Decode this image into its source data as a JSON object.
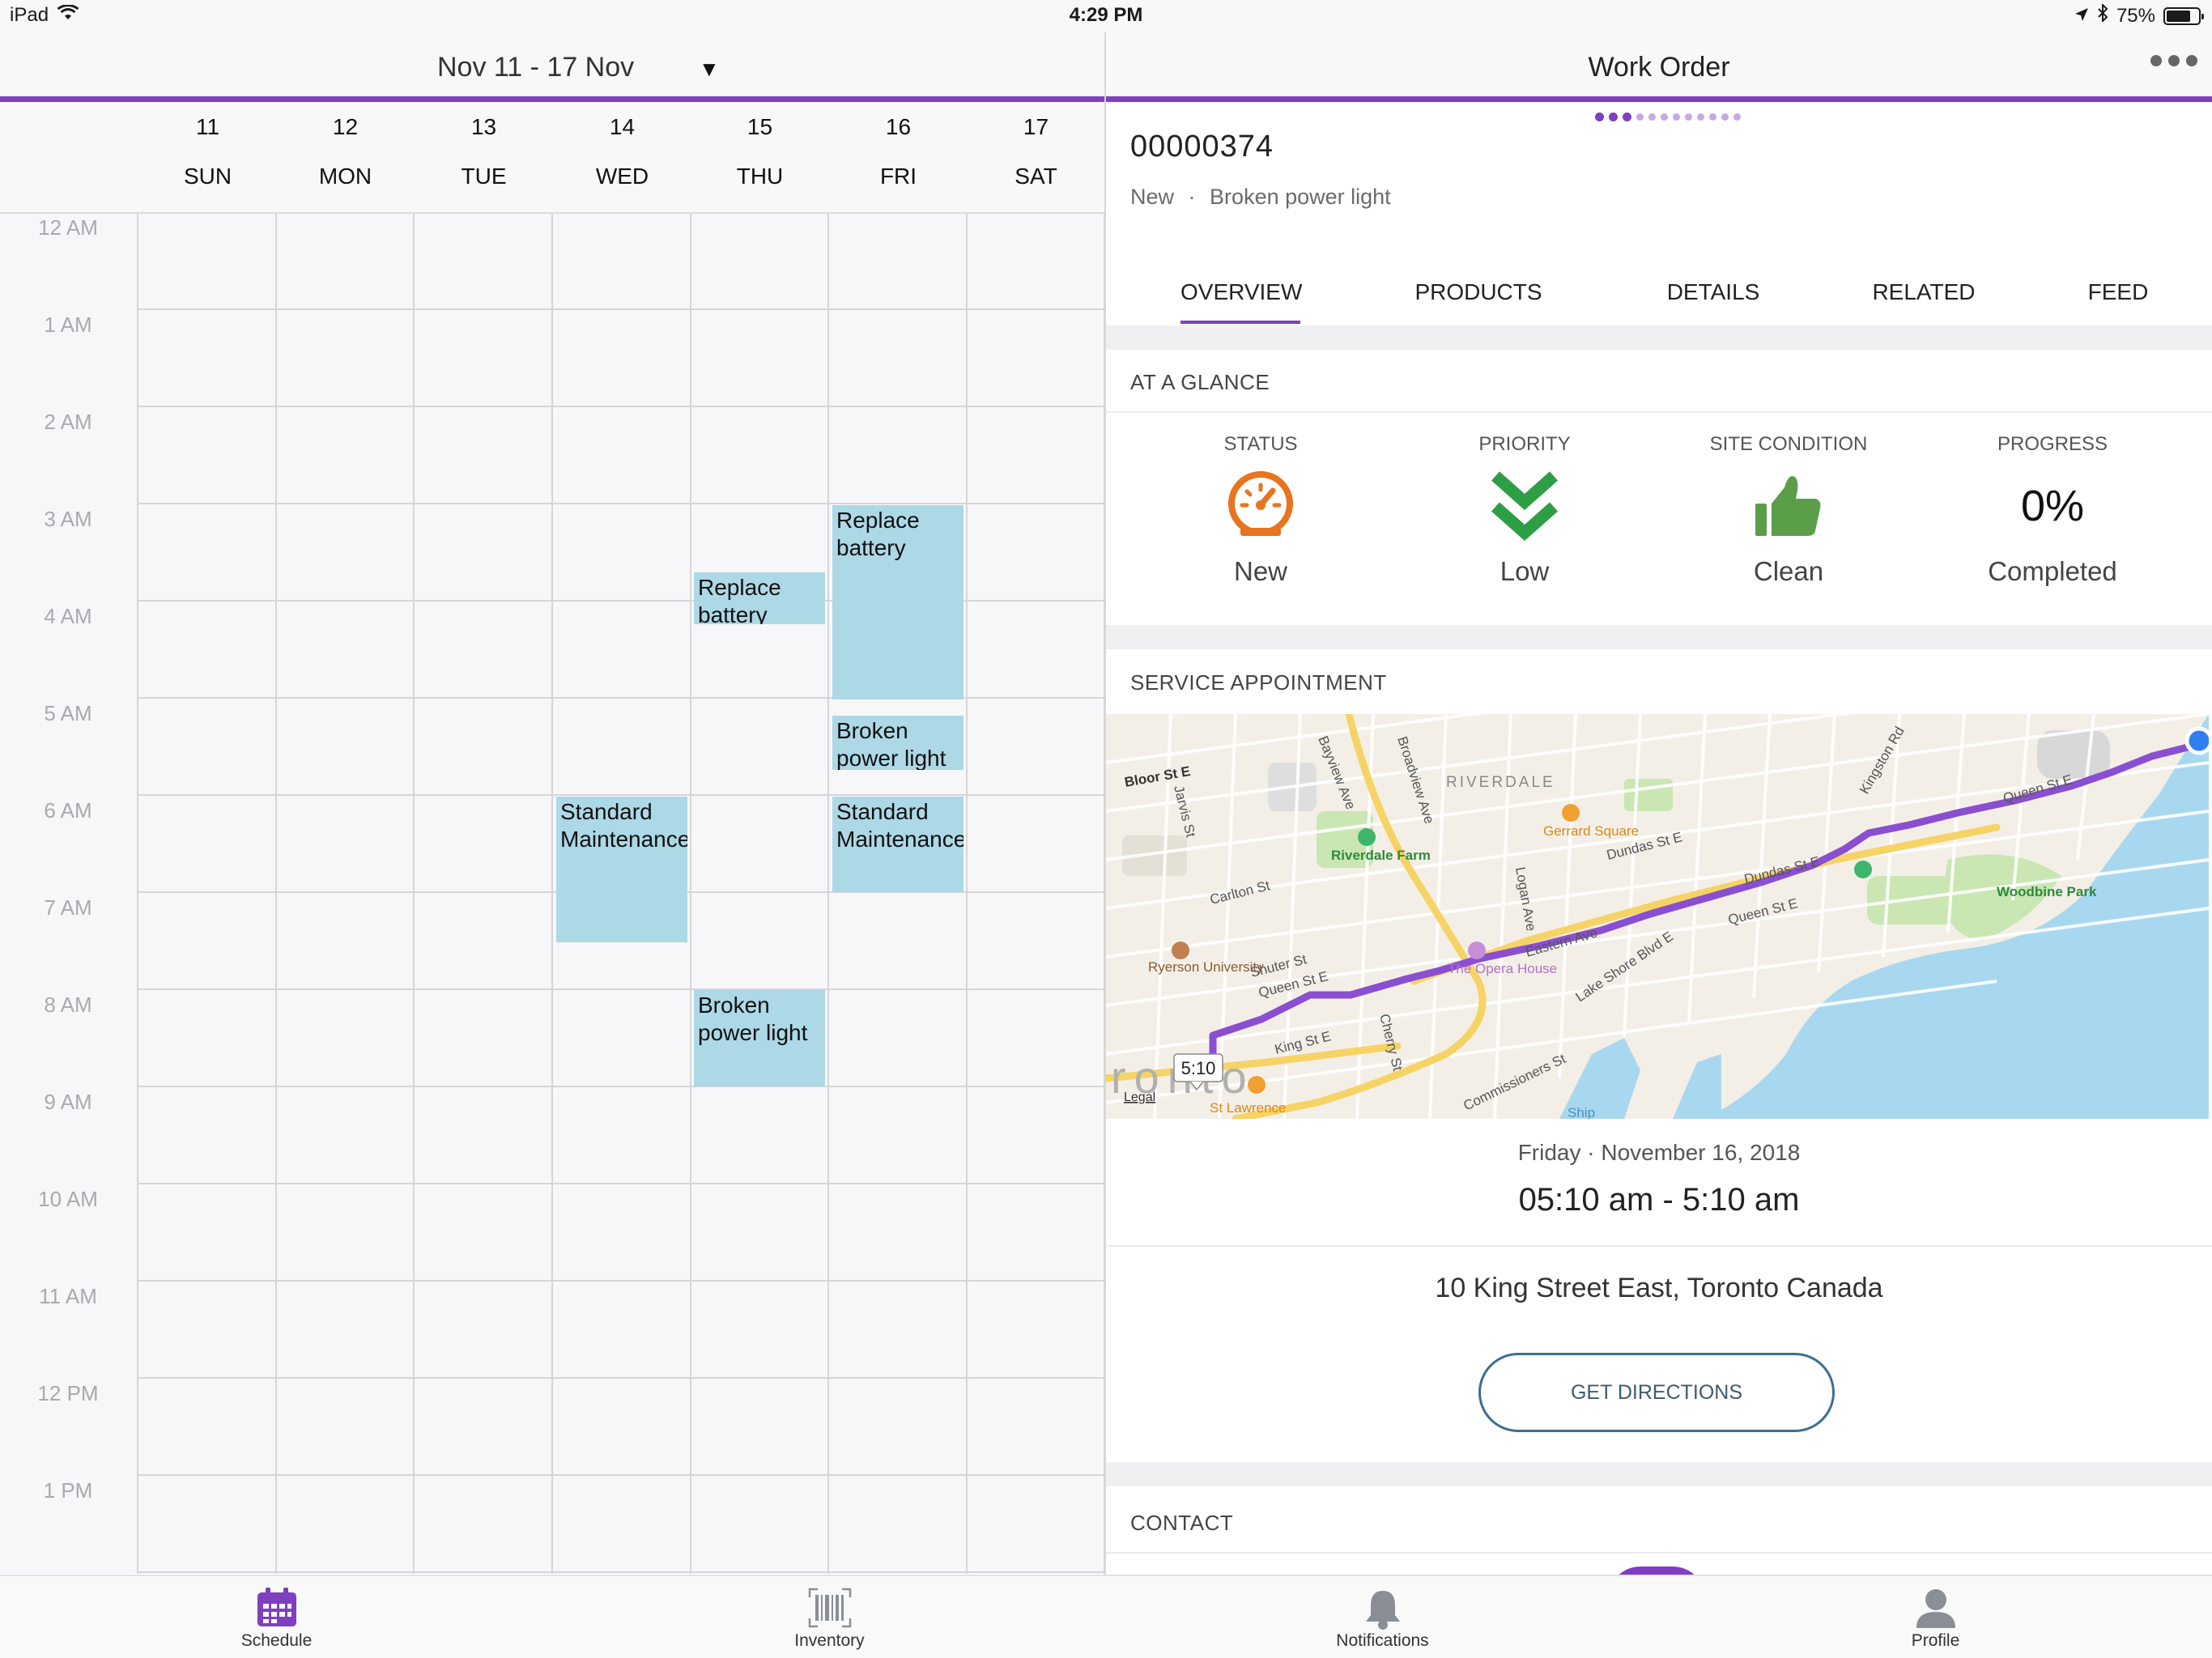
{
  "status_bar": {
    "device": "iPad",
    "time": "4:29 PM",
    "battery": "75%",
    "battery_level": 0.75
  },
  "calendar": {
    "range_title": "Nov 11 - 17 Nov",
    "days": [
      {
        "num": "11",
        "name": "SUN"
      },
      {
        "num": "12",
        "name": "MON"
      },
      {
        "num": "13",
        "name": "TUE"
      },
      {
        "num": "14",
        "name": "WED"
      },
      {
        "num": "15",
        "name": "THU"
      },
      {
        "num": "16",
        "name": "FRI"
      },
      {
        "num": "17",
        "name": "SAT"
      }
    ],
    "hours": [
      "12 AM",
      "1 AM",
      "2 AM",
      "3 AM",
      "4 AM",
      "5 AM",
      "6 AM",
      "7 AM",
      "8 AM",
      "9 AM",
      "10 AM",
      "11 AM",
      "12 PM",
      "1 PM"
    ],
    "events": [
      {
        "label": "Replace battery",
        "day": "FRI",
        "start": "3:00 AM",
        "end": "5:00 AM"
      },
      {
        "label": "Replace battery",
        "day": "THU",
        "start": "3:40 AM",
        "end": "4:15 AM"
      },
      {
        "label": "Broken power light",
        "day": "FRI",
        "start": "5:10 AM",
        "end": "5:45 AM"
      },
      {
        "label": "Standard Maintenance",
        "day": "WED",
        "start": "6:00 AM",
        "end": "7:30 AM"
      },
      {
        "label": "Standard Maintenance",
        "day": "FRI",
        "start": "6:00 AM",
        "end": "7:00 AM"
      },
      {
        "label": "Broken power light",
        "day": "THU",
        "start": "8:00 AM",
        "end": "9:00 AM"
      }
    ]
  },
  "work_order": {
    "header_title": "Work Order",
    "number": "00000374",
    "status_text": "New",
    "separator": "·",
    "subject": "Broken power light",
    "tabs": [
      "OVERVIEW",
      "PRODUCTS",
      "DETAILS",
      "RELATED",
      "FEED"
    ],
    "active_tab": "OVERVIEW",
    "at_a_glance": {
      "section_label": "AT A GLANCE",
      "items": [
        {
          "label": "STATUS",
          "value": "New",
          "icon": "gauge-icon",
          "color": "#e8741e"
        },
        {
          "label": "PRIORITY",
          "value": "Low",
          "icon": "double-chevron-down-icon",
          "color": "#2e9e45"
        },
        {
          "label": "SITE CONDITION",
          "value": "Clean",
          "icon": "thumbs-up-icon",
          "color": "#5a9e4a"
        },
        {
          "label": "PROGRESS",
          "value": "Completed",
          "big_value": "0%"
        }
      ]
    },
    "service_appointment": {
      "section_label": "SERVICE APPOINTMENT",
      "date": "Friday · November 16, 2018",
      "time_range": "05:10 am - 5:10 am",
      "address": "10 King Street East, Toronto Canada",
      "directions_label": "GET DIRECTIONS",
      "map": {
        "eta_label": "5:10",
        "legal": "Legal",
        "labels": [
          "Bloor St E",
          "RIVERDALE",
          "Riverdale Farm",
          "Gerrard Square",
          "Dundas St E",
          "Kingston Rd",
          "Queen St E",
          "Woodbine Park",
          "Carlton St",
          "Ryerson University",
          "Shuter St",
          "Queen St E",
          "King St E",
          "The Opera House",
          "Eastern Ave",
          "Lake Shore Blvd E",
          "Commissioners St",
          "St Lawrence",
          "Jarvis St",
          "Bayview Ave",
          "Broadview Ave",
          "Logan Ave",
          "Cherry St",
          "Queen St E",
          "Dundas St E",
          "Ship",
          "ronto"
        ]
      }
    },
    "contact": {
      "section_label": "CONTACT"
    }
  },
  "tab_bar": {
    "items": [
      {
        "label": "Schedule",
        "icon": "calendar-icon",
        "active": true
      },
      {
        "label": "Inventory",
        "icon": "barcode-icon",
        "active": false
      },
      {
        "label": "Notifications",
        "icon": "bell-icon",
        "active": false
      },
      {
        "label": "Profile",
        "icon": "person-icon",
        "active": false
      }
    ]
  },
  "colors": {
    "accent": "#7e3fc0",
    "event_fill": "#add8e6",
    "route": "#8a4fd0",
    "water": "#a8d8f0",
    "park": "#c9e6b3",
    "road_major": "#f6d365",
    "button_border": "#3b6e93"
  }
}
